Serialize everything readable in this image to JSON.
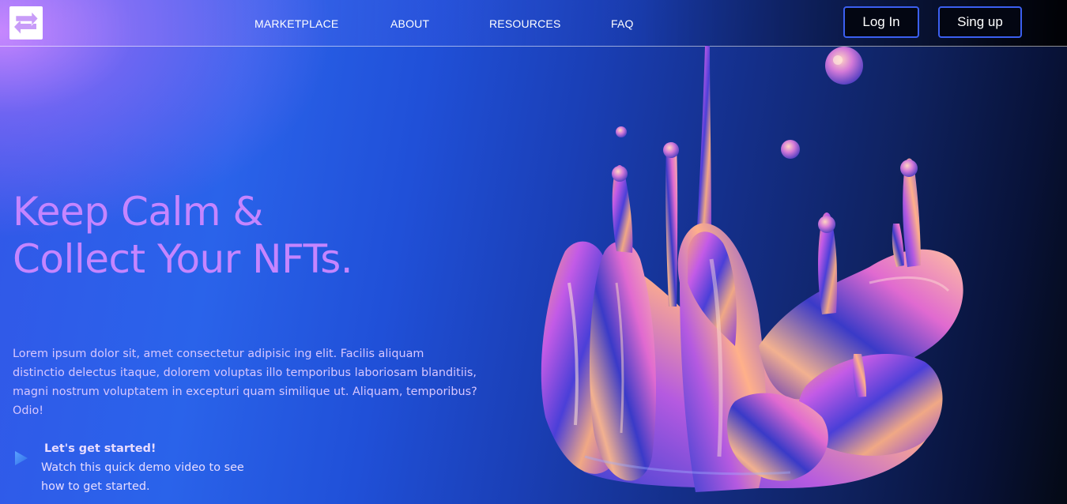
{
  "nav": {
    "items": [
      {
        "label": "MARKETPLACE"
      },
      {
        "label": "ABOUT"
      },
      {
        "label": "RESOURCES"
      },
      {
        "label": "FAQ"
      }
    ],
    "login_label": "Log In",
    "signup_label": "Sing up"
  },
  "hero": {
    "title_line1": "Keep Calm &",
    "title_line2": "Collect Your NFTs.",
    "description": "Lorem ipsum dolor sit, amet consectetur adipisic ing elit. Facilis aliquam distinctio delectus itaque, dolorem voluptas illo temporibus laboriosam blanditiis, magni nostrum voluptatem in excepturi quam similique ut. Aliquam, temporibus? Odio!"
  },
  "cta": {
    "title": "Let's get started!",
    "text": "Watch this quick demo video to see how to get started."
  },
  "icons": {
    "logo": "swap-arrows-logo",
    "play": "play-icon"
  },
  "colors": {
    "accent_title": "#c585ff",
    "button_border": "#3b5ff0",
    "button_bg": "#030612"
  }
}
